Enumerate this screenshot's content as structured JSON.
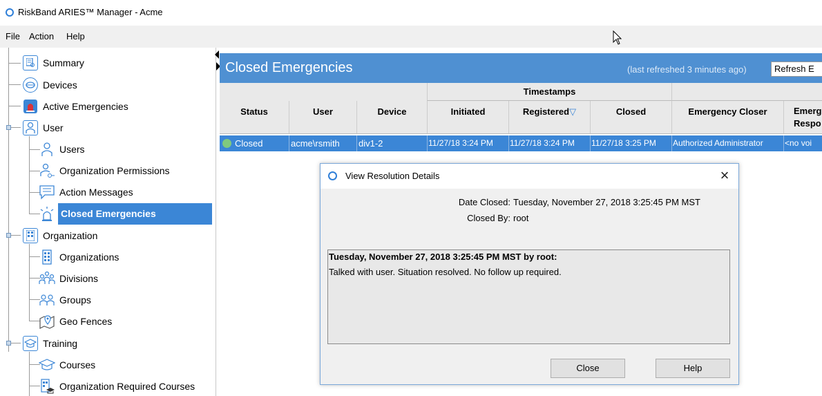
{
  "window": {
    "title": "RiskBand ARIES™ Manager - Acme"
  },
  "menu": {
    "file": "File",
    "action": "Action",
    "help": "Help"
  },
  "sidebar": {
    "items": [
      {
        "label": "Summary"
      },
      {
        "label": "Devices"
      },
      {
        "label": "Active Emergencies"
      },
      {
        "label": "User"
      },
      {
        "label": "Users"
      },
      {
        "label": "Organization Permissions"
      },
      {
        "label": "Action Messages"
      },
      {
        "label": "Closed Emergencies"
      },
      {
        "label": "Organization"
      },
      {
        "label": "Organizations"
      },
      {
        "label": "Divisions"
      },
      {
        "label": "Groups"
      },
      {
        "label": "Geo Fences"
      },
      {
        "label": "Training"
      },
      {
        "label": "Courses"
      },
      {
        "label": "Organization Required Courses"
      }
    ],
    "selected": "Closed Emergencies"
  },
  "main": {
    "title": "Closed Emergencies",
    "refreshed": "(last refreshed 3 minutes ago)",
    "refresh_button": "Refresh E"
  },
  "table": {
    "group_header": "Timestamps",
    "columns": {
      "status": "Status",
      "user": "User",
      "device": "Device",
      "initiated": "Initiated",
      "registered": "Registered",
      "closed": "Closed",
      "closer": "Emergency Closer",
      "responder_1": "Emerg",
      "responder_2": "Respo"
    },
    "sort_indicator": "▽",
    "rows": [
      {
        "status": "Closed",
        "user": "acme\\rsmith",
        "device": "div1-2",
        "initiated": "11/27/18 3:24 PM",
        "registered": "11/27/18 3:24 PM",
        "closed": "11/27/18 3:25 PM",
        "closer": "Authorized Administrator",
        "responder": "<no voi"
      }
    ]
  },
  "dialog": {
    "title": "View Resolution Details",
    "close_glyph": "×",
    "date_closed_label": "Date Closed:",
    "date_closed_value": "Tuesday, November 27, 2018 3:25:45 PM MST",
    "closed_by_label": "Closed By:",
    "closed_by_value": "root",
    "note_header": "Tuesday, November 27, 2018 3:25:45 PM MST by root:",
    "note_body": "Talked with user. Situation resolved. No follow up required.",
    "close_button": "Close",
    "help_button": "Help"
  },
  "colors": {
    "accent": "#3b86d6",
    "header": "#4f90d2",
    "status_closed": "#7fc97f"
  }
}
